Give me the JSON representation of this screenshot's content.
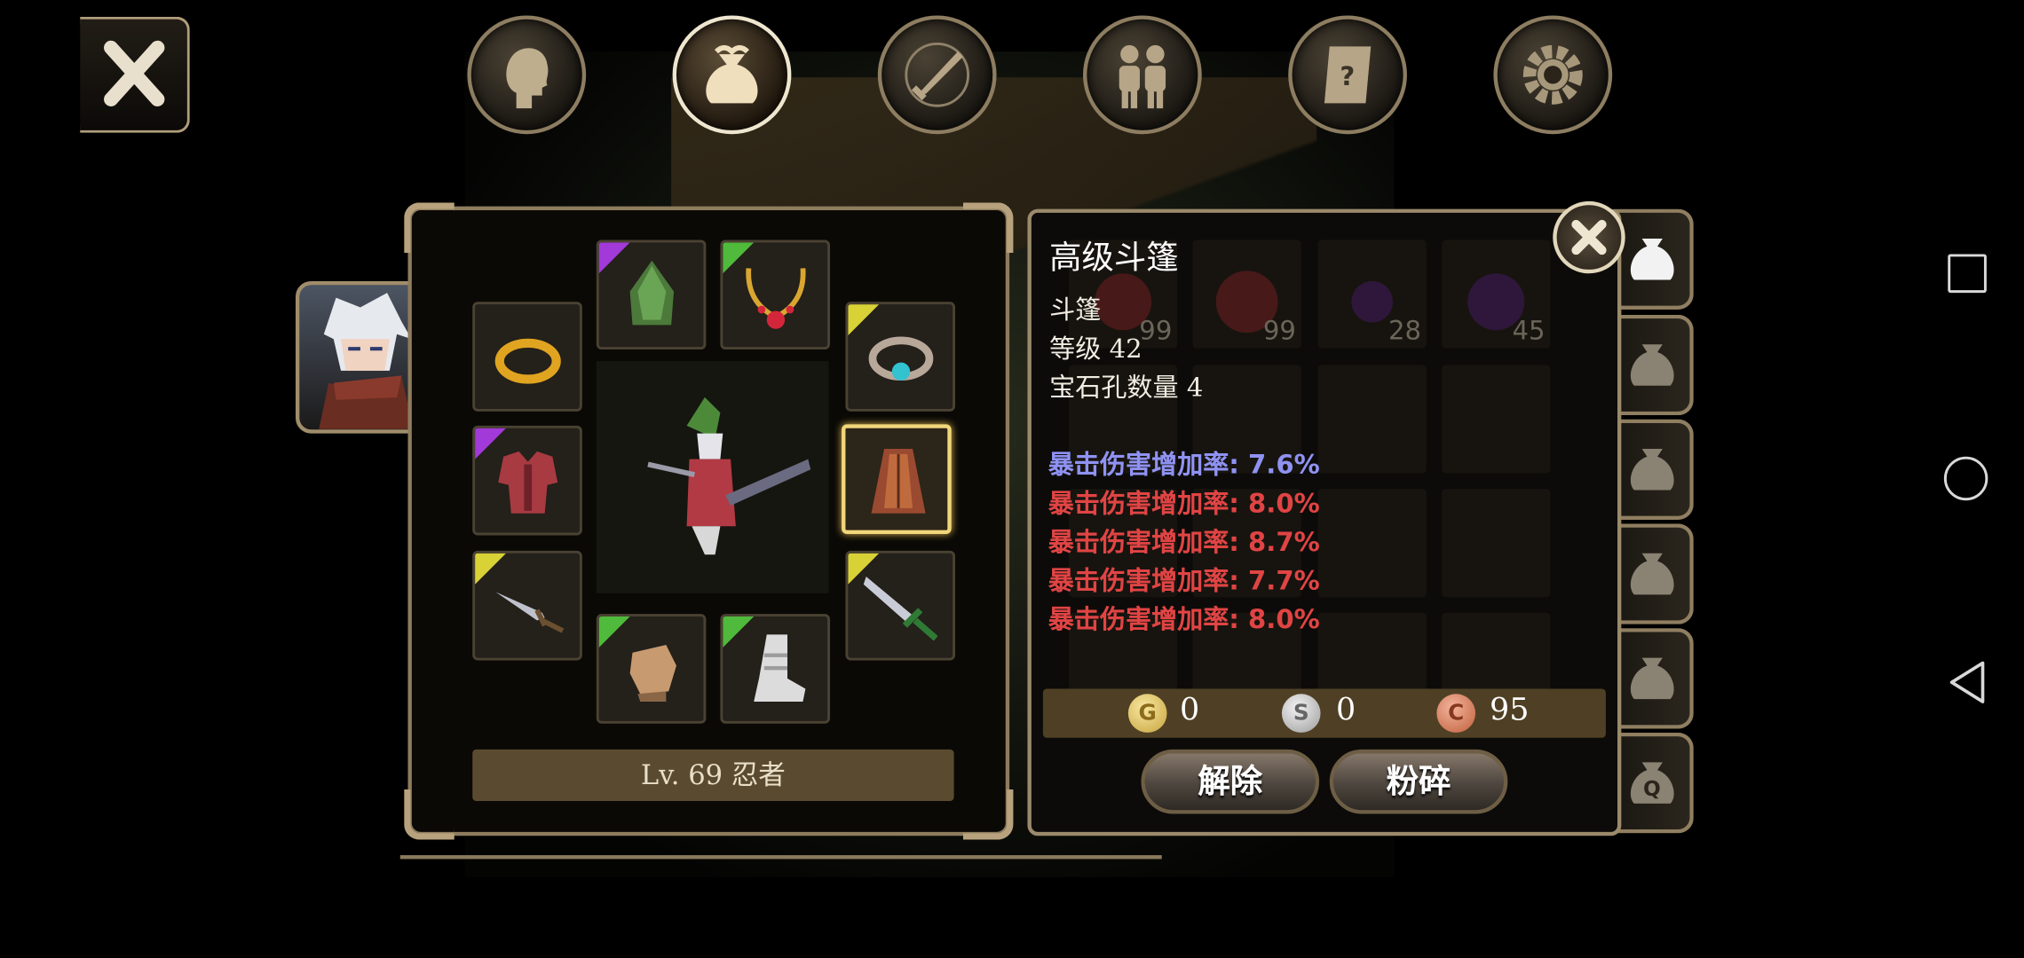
{
  "tabs": [
    {
      "name": "profile",
      "icon": "head-icon",
      "active": false
    },
    {
      "name": "bag",
      "icon": "bag-icon",
      "active": true
    },
    {
      "name": "skills",
      "icon": "sword-compass-icon",
      "active": false
    },
    {
      "name": "party",
      "icon": "people-icon",
      "active": false
    },
    {
      "name": "quests",
      "icon": "scroll-icon",
      "active": false
    },
    {
      "name": "settings",
      "icon": "gear-icon",
      "active": false
    }
  ],
  "character": {
    "level_text": "Lv. 69 忍者"
  },
  "equipment_slots": [
    {
      "name": "helmet",
      "icon": "green-hood-icon",
      "grade": "purple"
    },
    {
      "name": "necklace",
      "icon": "ruby-necklace-icon",
      "grade": "green"
    },
    {
      "name": "ring",
      "icon": "gold-ring-icon",
      "grade": ""
    },
    {
      "name": "earring",
      "icon": "jewel-ring-icon",
      "grade": "yellow"
    },
    {
      "name": "armor",
      "icon": "red-armor-icon",
      "grade": "purple"
    },
    {
      "name": "cloak",
      "icon": "cloak-icon",
      "grade": "",
      "selected": true
    },
    {
      "name": "weapon-left",
      "icon": "dagger-icon",
      "grade": "yellow"
    },
    {
      "name": "weapon-right",
      "icon": "greatsword-icon",
      "grade": "yellow"
    },
    {
      "name": "gloves",
      "icon": "glove-icon",
      "grade": "green"
    },
    {
      "name": "boots",
      "icon": "boot-icon",
      "grade": "green"
    }
  ],
  "item_detail": {
    "name": "高级斗篷",
    "type": "斗篷",
    "level": "等级 42",
    "sockets": "宝石孔数量 4",
    "stats": [
      {
        "text": "暴击伤害增加率: 7.6%",
        "color": "#8f92f2"
      },
      {
        "text": "暴击伤害增加率: 8.0%",
        "color": "#e04444"
      },
      {
        "text": "暴击伤害增加率: 8.7%",
        "color": "#e04444"
      },
      {
        "text": "暴击伤害增加率: 7.7%",
        "color": "#e04444"
      },
      {
        "text": "暴击伤害增加率: 8.0%",
        "color": "#e04444"
      }
    ],
    "buttons": {
      "unequip": "解除",
      "smash": "粉碎"
    }
  },
  "currency": {
    "gold": {
      "label": "G",
      "value": "0"
    },
    "silver": {
      "label": "S",
      "value": "0"
    },
    "copper": {
      "label": "C",
      "value": "95"
    }
  },
  "background_inventory": {
    "counts": [
      "99",
      "99",
      "28",
      "45"
    ]
  },
  "side_tabs": [
    "bag-icon",
    "bag-icon",
    "bag-icon",
    "bag-icon",
    "bag-icon",
    "quest-bag-icon"
  ],
  "side_tab_q_label": "Q"
}
